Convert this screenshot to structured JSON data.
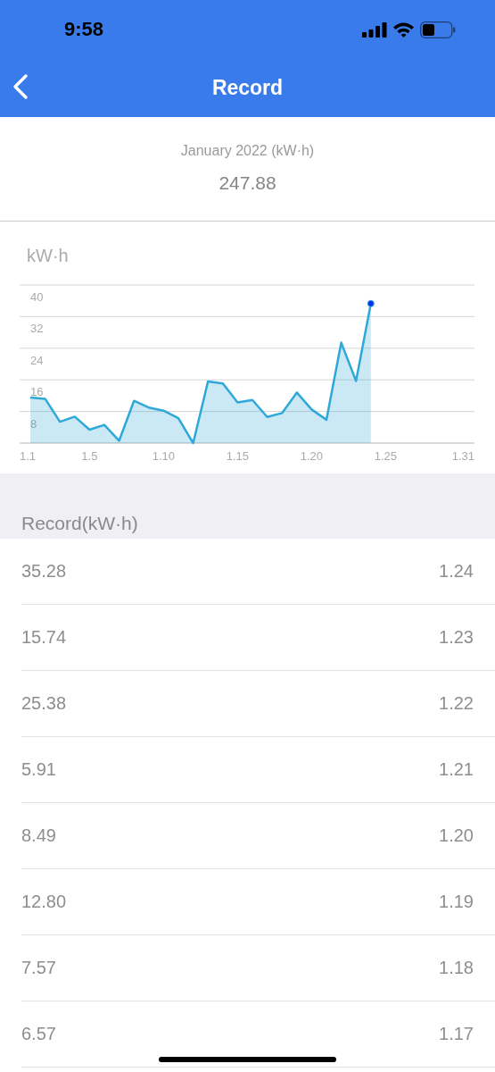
{
  "status_bar": {
    "time": "9:58"
  },
  "nav": {
    "title": "Record"
  },
  "summary": {
    "period": "January 2022 (kW·h)",
    "total": "247.88"
  },
  "chart": {
    "chart_data": {
      "type": "area",
      "ylabel": "kW·h",
      "categories": [
        "1.1",
        null,
        null,
        null,
        "1.5",
        null,
        null,
        null,
        null,
        "1.10",
        null,
        null,
        null,
        null,
        "1.15",
        null,
        null,
        null,
        null,
        "1.20",
        null,
        null,
        null,
        null,
        "1.25",
        null,
        null,
        null,
        null,
        null,
        "1.31"
      ],
      "series": [
        {
          "color": "#2ea8d8",
          "values": [
            11.5,
            11.2,
            5.4,
            6.7,
            3.4,
            4.6,
            0.6,
            10.7,
            9.0,
            8.2,
            6.3,
            0,
            15.6,
            15.1,
            10.3,
            10.9,
            6.6,
            7.6,
            12.8,
            8.5,
            5.9,
            25.4,
            15.7,
            35.3,
            null,
            null,
            null,
            null,
            null,
            null,
            null
          ]
        }
      ],
      "ylim": [
        0,
        40
      ],
      "grid": true,
      "yticks": [
        8,
        16,
        24,
        32,
        40
      ]
    }
  },
  "records": {
    "title": "Record(kW·h)",
    "rows": [
      {
        "value": "35.28",
        "date": "1.24"
      },
      {
        "value": "15.74",
        "date": "1.23"
      },
      {
        "value": "25.38",
        "date": "1.22"
      },
      {
        "value": "5.91",
        "date": "1.21"
      },
      {
        "value": "8.49",
        "date": "1.20"
      },
      {
        "value": "12.80",
        "date": "1.19"
      },
      {
        "value": "7.57",
        "date": "1.18"
      },
      {
        "value": "6.57",
        "date": "1.17"
      }
    ]
  }
}
